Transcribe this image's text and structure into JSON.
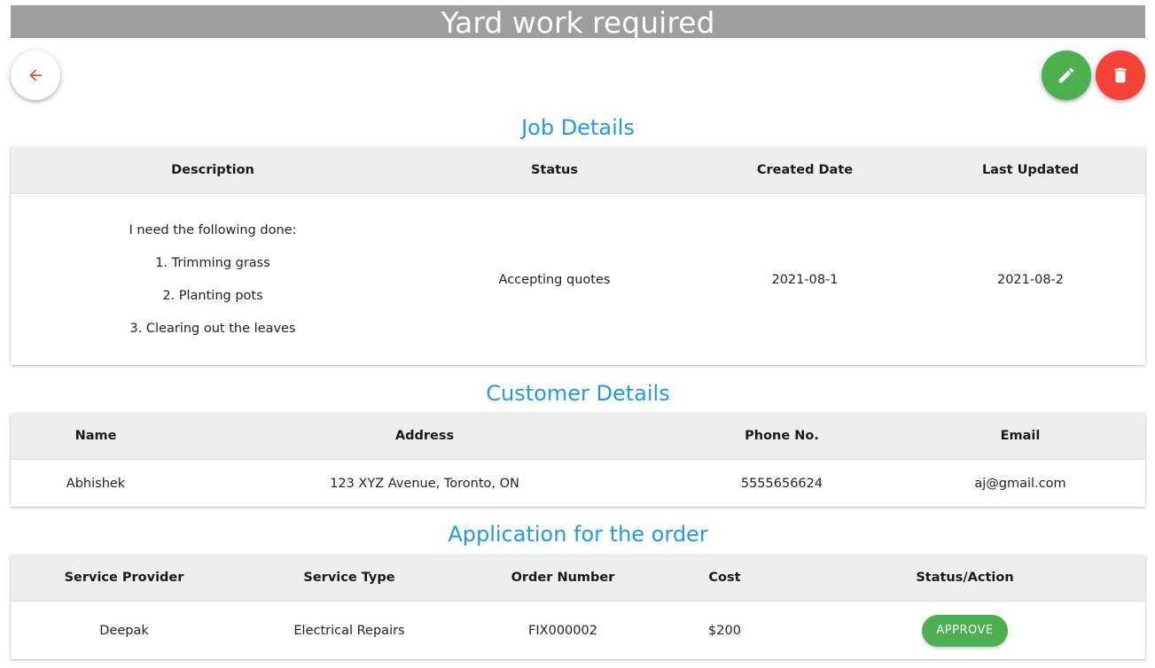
{
  "header": {
    "title": "Yard work required"
  },
  "actions": {
    "back_icon": "arrow-left-icon",
    "edit_icon": "pencil-icon",
    "delete_icon": "trash-icon",
    "colors": {
      "back": "#f44336",
      "edit": "#4caf50",
      "delete": "#f44336"
    }
  },
  "job": {
    "section_title": "Job Details",
    "columns": [
      "Description",
      "Status",
      "Created Date",
      "Last Updated"
    ],
    "description_lines": [
      "I need the following done:",
      "1. Trimming grass",
      "2. Planting pots",
      "3. Clearing out the leaves"
    ],
    "status": "Accepting quotes",
    "created_date": "2021-08-1",
    "last_updated": "2021-08-2"
  },
  "customer": {
    "section_title": "Customer Details",
    "columns": [
      "Name",
      "Address",
      "Phone No.",
      "Email"
    ],
    "name": "Abhishek",
    "address": "123 XYZ Avenue, Toronto, ON",
    "phone": "5555656624",
    "email": "aj@gmail.com"
  },
  "applications": {
    "section_title": "Application for the order",
    "columns": [
      "Service Provider",
      "Service Type",
      "Order Number",
      "Cost",
      "Status/Action"
    ],
    "rows": [
      {
        "provider": "Deepak",
        "service_type": "Electrical Repairs",
        "order_number": "FIX000002",
        "cost": "$200",
        "action_label": "APPROVE"
      }
    ]
  }
}
